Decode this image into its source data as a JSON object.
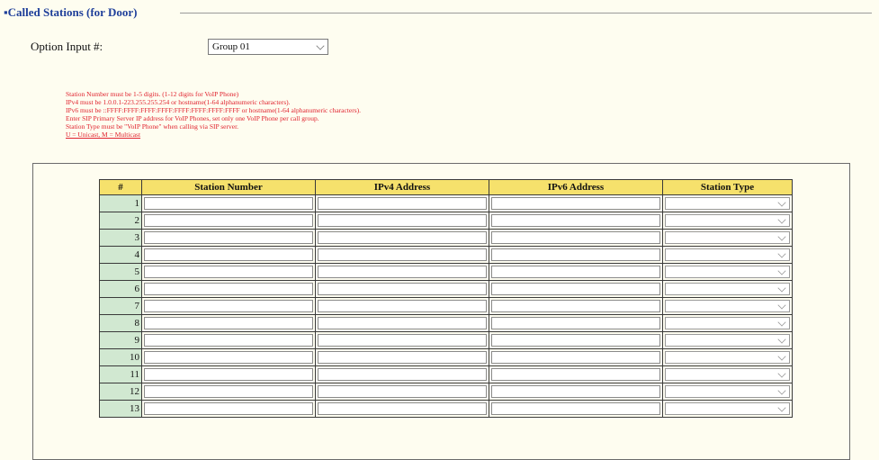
{
  "section": {
    "title": "▪Called Stations (for Door)"
  },
  "option": {
    "label": "Option Input #:",
    "selected": "Group 01"
  },
  "notes": [
    "Station Number must be 1-5 digits. (1-12 digits for VoIP Phone)",
    "IPv4 must be 1.0.0.1-223.255.255.254 or hostname(1-64 alphanumeric characters).",
    "IPv6 must be ::FFFF:FFFF:FFFF:FFFF:FFFF:FFFF:FFFF:FFFF or hostname(1-64 alphanumeric characters).",
    "Enter SIP Primary Server IP address for VoIP Phones, set only one VoIP Phone per call group.",
    "Station Type must be \"VoIP Phone\" when calling via SIP server.",
    "U = Unicast, M = Multicast"
  ],
  "table": {
    "columns": [
      "#",
      "Station Number",
      "IPv4 Address",
      "IPv6 Address",
      "Station Type"
    ],
    "rows": [
      "1",
      "2",
      "3",
      "4",
      "5",
      "6",
      "7",
      "8",
      "9",
      "10",
      "11",
      "12",
      "13"
    ]
  }
}
